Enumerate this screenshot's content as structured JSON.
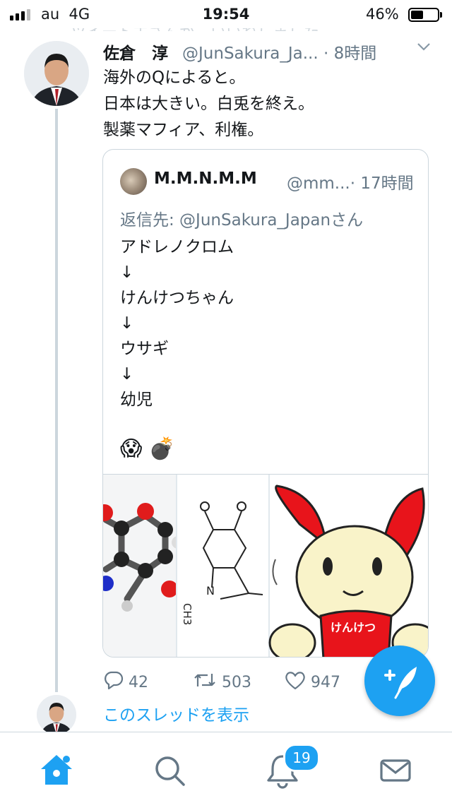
{
  "status_bar": {
    "carrier": "au",
    "network": "4G",
    "time": "19:54",
    "battery": "46%",
    "battery_level": 0.46
  },
  "context_line": "ツイート主さんが…いいねしました",
  "tweet": {
    "author_name": "佐倉　淳",
    "author_handle": "@JunSakura_Ja...",
    "time": "· 8時間",
    "lines": [
      "海外のQによると。",
      "日本は大きい。白兎を終え。",
      "製薬マフィア、利権。"
    ],
    "quote": {
      "name": "M.M.N.M.M",
      "handle": "@mm...",
      "time": "· 17時間",
      "reply_to": "返信先: @JunSakura_Japanさん",
      "lines": [
        "アドレノクロム",
        "↓",
        "けんけつちゃん",
        "↓",
        "ウサギ",
        "↓",
        "幼児"
      ],
      "emoji": "😱 💣",
      "mascot_text": "けんけつ"
    },
    "actions": {
      "reply_count": "42",
      "retweet_count": "503",
      "like_count": "947"
    }
  },
  "show_thread": "このスレッドを表示",
  "tabbar": {
    "notifications_badge": "19"
  },
  "colors": {
    "accent": "#1da1f2",
    "secondary_text": "#657786",
    "border": "#ccd6dd"
  },
  "icons": [
    "signal-icon",
    "battery-icon",
    "chevron-down-icon",
    "reply-icon",
    "retweet-icon",
    "like-icon",
    "compose-tweet-icon",
    "home-icon",
    "search-icon",
    "notifications-icon",
    "messages-icon"
  ]
}
